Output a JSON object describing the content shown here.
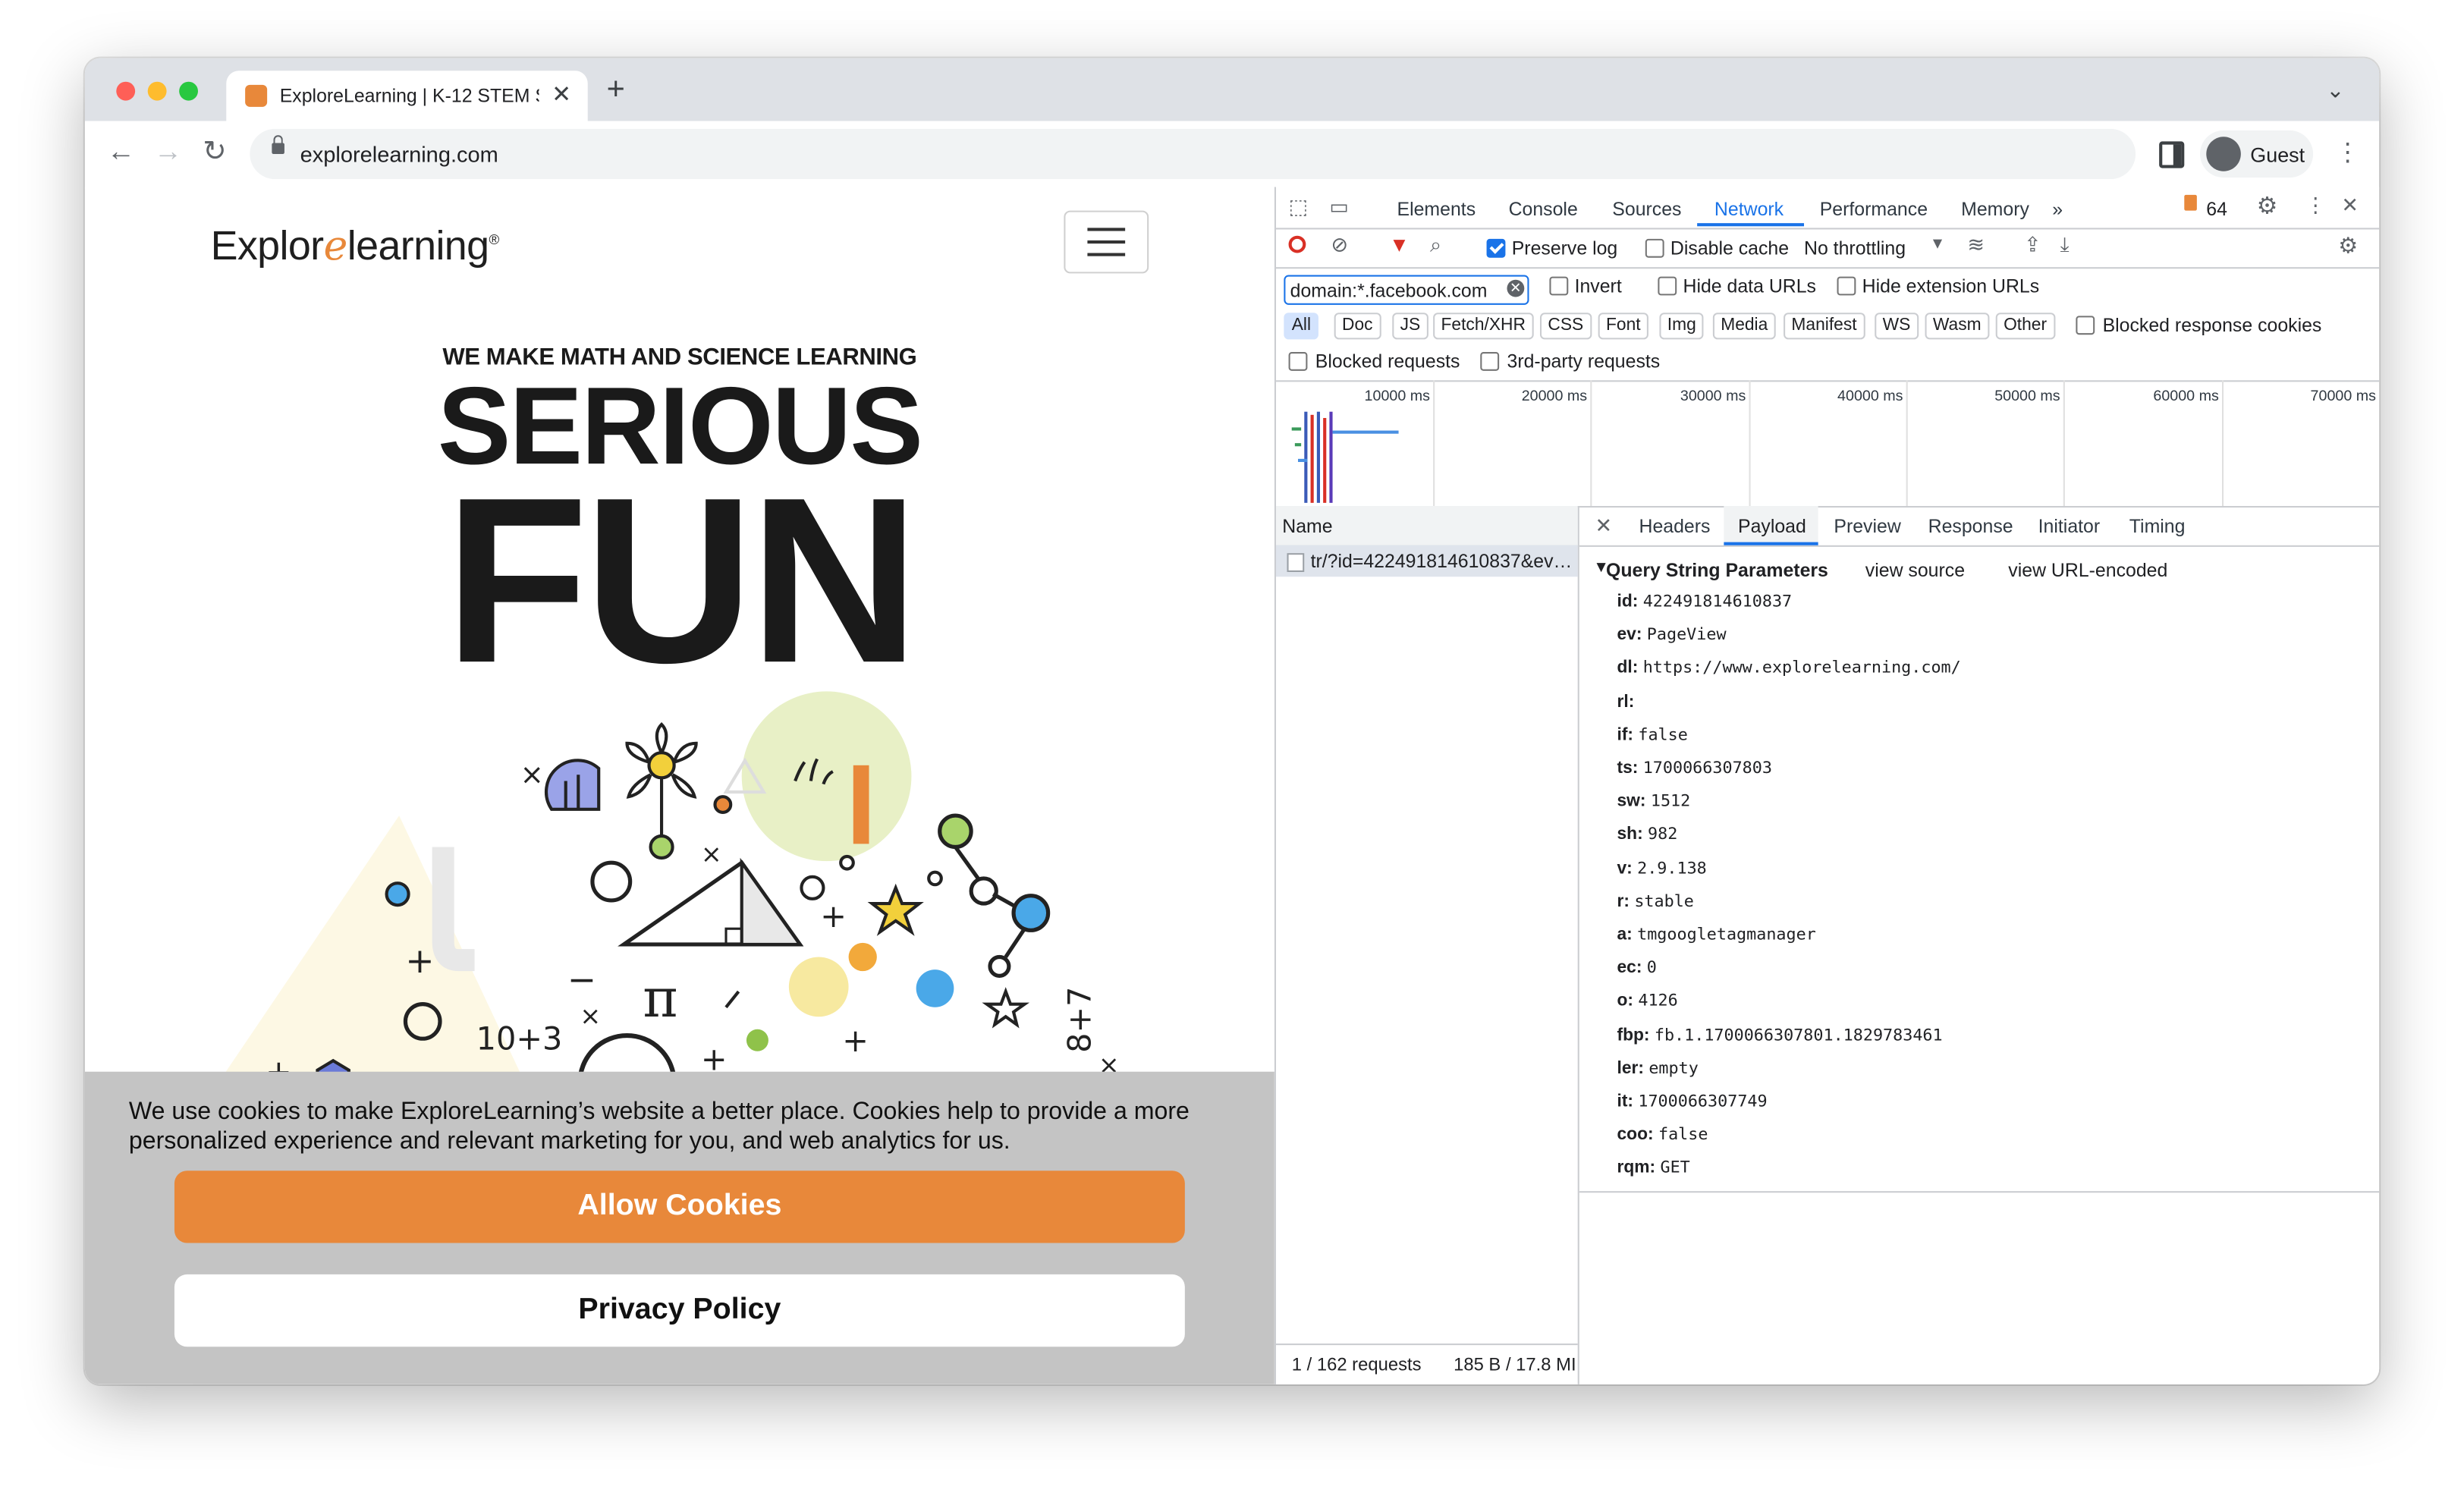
{
  "browser": {
    "tab_title": "ExploreLearning | K-12 STEM S",
    "new_tab_symbol": "+",
    "url": "explorelearning.com",
    "profile_label": "Guest"
  },
  "page": {
    "logo_text_before": "Explor",
    "logo_text_e": "e",
    "logo_text_after": "learning",
    "logo_mark": "®",
    "tagline": "WE MAKE MATH AND SCIENCE LEARNING",
    "headline_1": "SERIOUS",
    "headline_2": "FUN",
    "illustration_text": "10+3",
    "cookie_text": "We use cookies to make ExploreLearning’s website a better place. Cookies help to provide a more personalized experience and relevant marketing for you, and web analytics for us.",
    "allow_button": "Allow Cookies",
    "privacy_button": "Privacy Policy"
  },
  "devtools": {
    "tabs": [
      "Elements",
      "Console",
      "Sources",
      "Network",
      "Performance",
      "Memory"
    ],
    "more_tabs": "»",
    "issues_count": "64",
    "preserve_log": "Preserve log",
    "disable_cache": "Disable cache",
    "throttling": "No throttling",
    "filter_value": "domain:*.facebook.com",
    "invert": "Invert",
    "hide_data_urls": "Hide data URLs",
    "hide_extension_urls": "Hide extension URLs",
    "type_filters": [
      "All",
      "Doc",
      "JS",
      "Fetch/XHR",
      "CSS",
      "Font",
      "Img",
      "Media",
      "Manifest",
      "WS",
      "Wasm",
      "Other"
    ],
    "blocked_response_cookies": "Blocked response cookies",
    "blocked_requests": "Blocked requests",
    "third_party": "3rd-party requests",
    "timeline_ticks": [
      "10000 ms",
      "20000 ms",
      "30000 ms",
      "40000 ms",
      "50000 ms",
      "60000 ms",
      "70000 ms"
    ],
    "name_header": "Name",
    "request_name": "tr/?id=422491814610837&ev…",
    "detail_tabs": [
      "Headers",
      "Payload",
      "Preview",
      "Response",
      "Initiator",
      "Timing"
    ],
    "query_header": "Query String Parameters",
    "view_source": "view source",
    "view_url_encoded": "view URL-encoded",
    "params": [
      {
        "k": "id:",
        "v": "422491814610837"
      },
      {
        "k": "ev:",
        "v": "PageView"
      },
      {
        "k": "dl:",
        "v": "https://www.explorelearning.com/"
      },
      {
        "k": "rl:",
        "v": ""
      },
      {
        "k": "if:",
        "v": "false"
      },
      {
        "k": "ts:",
        "v": "1700066307803"
      },
      {
        "k": "sw:",
        "v": "1512"
      },
      {
        "k": "sh:",
        "v": "982"
      },
      {
        "k": "v:",
        "v": "2.9.138"
      },
      {
        "k": "r:",
        "v": "stable"
      },
      {
        "k": "a:",
        "v": "tmgoogletagmanager"
      },
      {
        "k": "ec:",
        "v": "0"
      },
      {
        "k": "o:",
        "v": "4126"
      },
      {
        "k": "fbp:",
        "v": "fb.1.1700066307801.1829783461"
      },
      {
        "k": "ler:",
        "v": "empty"
      },
      {
        "k": "it:",
        "v": "1700066307749"
      },
      {
        "k": "coo:",
        "v": "false"
      },
      {
        "k": "rqm:",
        "v": "GET"
      }
    ],
    "status_requests": "1 / 162 requests",
    "status_size": "185 B / 17.8 MI"
  }
}
